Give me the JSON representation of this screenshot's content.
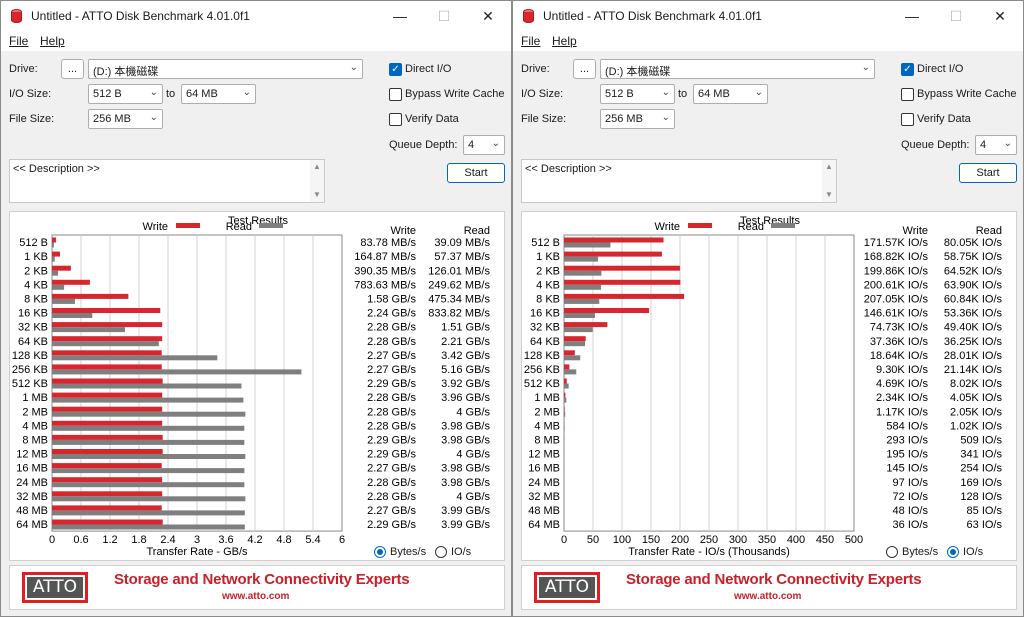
{
  "colors": {
    "write": "#d7262d",
    "read": "#7f7f7f",
    "accent": "#0067c0",
    "brand": "#c8202a"
  },
  "menu": {
    "file": "File",
    "help": "Help"
  },
  "labels": {
    "drive": "Drive:",
    "browse": "...",
    "io_size": "I/O Size:",
    "to": "to",
    "file_size": "File Size:",
    "direct_io": "Direct I/O",
    "bypass_write_cache": "Bypass Write Cache",
    "verify_data": "Verify Data",
    "queue_depth": "Queue Depth:",
    "start": "Start",
    "description": "<< Description >>",
    "test_results": "Test Results",
    "write": "Write",
    "read": "Read",
    "bytes_per_sec": "Bytes/s",
    "io_per_sec": "IO/s",
    "tagline": "Storage and Network Connectivity Experts",
    "url": "www.atto.com",
    "logo": "ATTO"
  },
  "windows": [
    {
      "title": "Untitled - ATTO Disk Benchmark 4.01.0f1",
      "drive": "(D:) 本機磁碟",
      "io_size_from": "512 B",
      "io_size_to": "64 MB",
      "file_size": "256 MB",
      "queue_depth": "4",
      "direct_io": true,
      "bypass_write_cache": false,
      "verify_data": false,
      "units_selected": "Bytes/s",
      "chart_data": {
        "type": "bar",
        "orientation": "horizontal",
        "title": "Test Results",
        "xlabel": "Transfer Rate - GB/s",
        "xlim": [
          0,
          6
        ],
        "xticks": [
          "0",
          "0.6",
          "1.2",
          "1.8",
          "2.4",
          "3",
          "3.6",
          "4.2",
          "4.8",
          "5.4",
          "6"
        ],
        "categories": [
          "512 B",
          "1 KB",
          "2 KB",
          "4 KB",
          "8 KB",
          "16 KB",
          "32 KB",
          "64 KB",
          "128 KB",
          "256 KB",
          "512 KB",
          "1 MB",
          "2 MB",
          "4 MB",
          "8 MB",
          "12 MB",
          "16 MB",
          "24 MB",
          "32 MB",
          "48 MB",
          "64 MB"
        ],
        "series": [
          {
            "name": "Write",
            "values": [
              0.084,
              0.165,
              0.39,
              0.784,
              1.58,
              2.24,
              2.28,
              2.28,
              2.27,
              2.27,
              2.29,
              2.28,
              2.28,
              2.28,
              2.29,
              2.29,
              2.27,
              2.28,
              2.28,
              2.27,
              2.29
            ]
          },
          {
            "name": "Read",
            "values": [
              0.039,
              0.057,
              0.126,
              0.25,
              0.475,
              0.834,
              1.51,
              2.21,
              3.42,
              5.16,
              3.92,
              3.96,
              4.0,
              3.98,
              3.98,
              4.0,
              3.98,
              3.98,
              4.0,
              3.99,
              3.99
            ]
          }
        ],
        "write_labels": [
          "83.78 MB/s",
          "164.87 MB/s",
          "390.35 MB/s",
          "783.63 MB/s",
          "1.58 GB/s",
          "2.24 GB/s",
          "2.28 GB/s",
          "2.28 GB/s",
          "2.27 GB/s",
          "2.27 GB/s",
          "2.29 GB/s",
          "2.28 GB/s",
          "2.28 GB/s",
          "2.28 GB/s",
          "2.29 GB/s",
          "2.29 GB/s",
          "2.27 GB/s",
          "2.28 GB/s",
          "2.28 GB/s",
          "2.27 GB/s",
          "2.29 GB/s"
        ],
        "read_labels": [
          "39.09 MB/s",
          "57.37 MB/s",
          "126.01 MB/s",
          "249.62 MB/s",
          "475.34 MB/s",
          "833.82 MB/s",
          "1.51 GB/s",
          "2.21 GB/s",
          "3.42 GB/s",
          "5.16 GB/s",
          "3.92 GB/s",
          "3.96 GB/s",
          "4 GB/s",
          "3.98 GB/s",
          "3.98 GB/s",
          "4 GB/s",
          "3.98 GB/s",
          "3.98 GB/s",
          "4 GB/s",
          "3.99 GB/s",
          "3.99 GB/s"
        ]
      }
    },
    {
      "title": "Untitled - ATTO Disk Benchmark 4.01.0f1",
      "drive": "(D:) 本機磁碟",
      "io_size_from": "512 B",
      "io_size_to": "64 MB",
      "file_size": "256 MB",
      "queue_depth": "4",
      "direct_io": true,
      "bypass_write_cache": false,
      "verify_data": false,
      "units_selected": "IO/s",
      "chart_data": {
        "type": "bar",
        "orientation": "horizontal",
        "title": "Test Results",
        "xlabel": "Transfer Rate - IO/s (Thousands)",
        "xlim": [
          0,
          500
        ],
        "xticks": [
          "0",
          "50",
          "100",
          "150",
          "200",
          "250",
          "300",
          "350",
          "400",
          "450",
          "500"
        ],
        "categories": [
          "512 B",
          "1 KB",
          "2 KB",
          "4 KB",
          "8 KB",
          "16 KB",
          "32 KB",
          "64 KB",
          "128 KB",
          "256 KB",
          "512 KB",
          "1 MB",
          "2 MB",
          "4 MB",
          "8 MB",
          "12 MB",
          "16 MB",
          "24 MB",
          "32 MB",
          "48 MB",
          "64 MB"
        ],
        "series": [
          {
            "name": "Write",
            "values": [
              171.57,
              168.82,
              199.86,
              200.61,
              207.05,
              146.61,
              74.73,
              37.36,
              18.64,
              9.3,
              4.69,
              2.34,
              1.17,
              0.584,
              0.293,
              0.195,
              0.145,
              0.097,
              0.072,
              0.048,
              0.036
            ]
          },
          {
            "name": "Read",
            "values": [
              80.05,
              58.75,
              64.52,
              63.9,
              60.84,
              53.36,
              49.4,
              36.25,
              28.01,
              21.14,
              8.02,
              4.05,
              2.05,
              1.02,
              0.509,
              0.341,
              0.254,
              0.169,
              0.128,
              0.085,
              0.063
            ]
          }
        ],
        "write_labels": [
          "171.57K IO/s",
          "168.82K IO/s",
          "199.86K IO/s",
          "200.61K IO/s",
          "207.05K IO/s",
          "146.61K IO/s",
          "74.73K IO/s",
          "37.36K IO/s",
          "18.64K IO/s",
          "9.30K IO/s",
          "4.69K IO/s",
          "2.34K IO/s",
          "1.17K IO/s",
          "584 IO/s",
          "293 IO/s",
          "195 IO/s",
          "145 IO/s",
          "97 IO/s",
          "72 IO/s",
          "48 IO/s",
          "36 IO/s"
        ],
        "read_labels": [
          "80.05K IO/s",
          "58.75K IO/s",
          "64.52K IO/s",
          "63.90K IO/s",
          "60.84K IO/s",
          "53.36K IO/s",
          "49.40K IO/s",
          "36.25K IO/s",
          "28.01K IO/s",
          "21.14K IO/s",
          "8.02K IO/s",
          "4.05K IO/s",
          "2.05K IO/s",
          "1.02K IO/s",
          "509 IO/s",
          "341 IO/s",
          "254 IO/s",
          "169 IO/s",
          "128 IO/s",
          "85 IO/s",
          "63 IO/s"
        ]
      }
    }
  ]
}
